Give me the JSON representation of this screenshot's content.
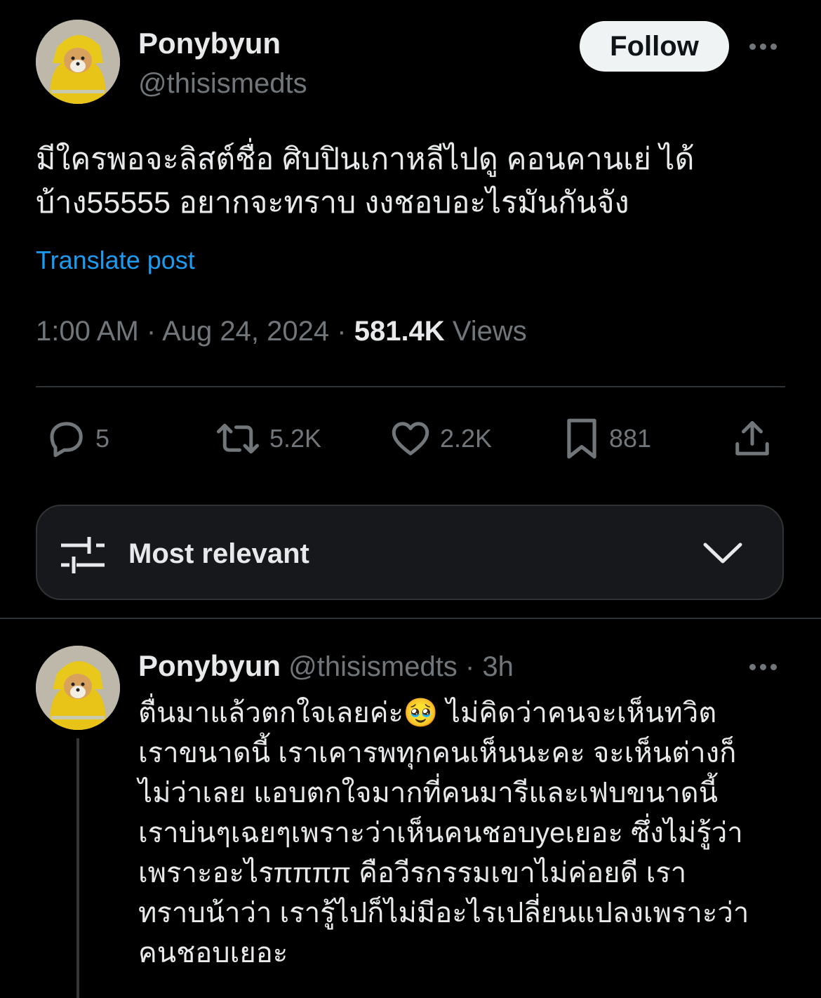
{
  "post": {
    "author": {
      "display_name": "Ponybyun",
      "handle": "@thisismedts",
      "avatar": "corgi-in-yellow-raincoat"
    },
    "follow_label": "Follow",
    "text": "มีใครพอจะลิสต์ชื่อ ศิบปินเกาหลีไปดู คอนคานเย่ ได้\nบ้าง55555 อยากจะทราบ งงชอบอะไรมันกันจัง",
    "translate_label": "Translate post",
    "time": "1:00 AM",
    "separator": "·",
    "date": "Aug 24, 2024",
    "views_count": "581.4K",
    "views_label": "Views",
    "actions": {
      "replies": "5",
      "reposts": "5.2K",
      "likes": "2.2K",
      "bookmarks": "881"
    }
  },
  "sort": {
    "label": "Most relevant"
  },
  "reply": {
    "display_name": "Ponybyun",
    "handle": "@thisismedts",
    "separator": "·",
    "age": "3h",
    "text": "ตื่นมาแล้วตกใจเลยค่ะ🥹 ไม่คิดว่าคนจะเห็นทวิต\nเราขนาดนี้ เราเคารพทุกคนเห็นนะคะ จะเห็นต่างก็\nไม่ว่าเลย แอบตกใจมากที่คนมารีและเฟบขนาดนี้\nเราบ่นๆเฉยๆเพราะว่าเห็นคนชอบyeเยอะ ซึ่งไม่รู้ว่า\nเพราะอะไรππππ คือวีรกรรมเขาไม่ค่อยดี เรา\nทราบน้าว่า เรารู้ไปก็ไม่มีอะไรเปลี่ยนแปลงเพราะว่า\nคนชอบเยอะ"
  },
  "icons": [
    "reply-icon",
    "repost-icon",
    "like-icon",
    "bookmark-icon",
    "share-icon",
    "sort-filter-icon",
    "chevron-down-icon",
    "more-icon"
  ],
  "colors": {
    "background": "#000000",
    "text": "#e7e9ea",
    "muted": "#71767b",
    "link": "#1d9bf0",
    "divider": "#2f3336"
  }
}
